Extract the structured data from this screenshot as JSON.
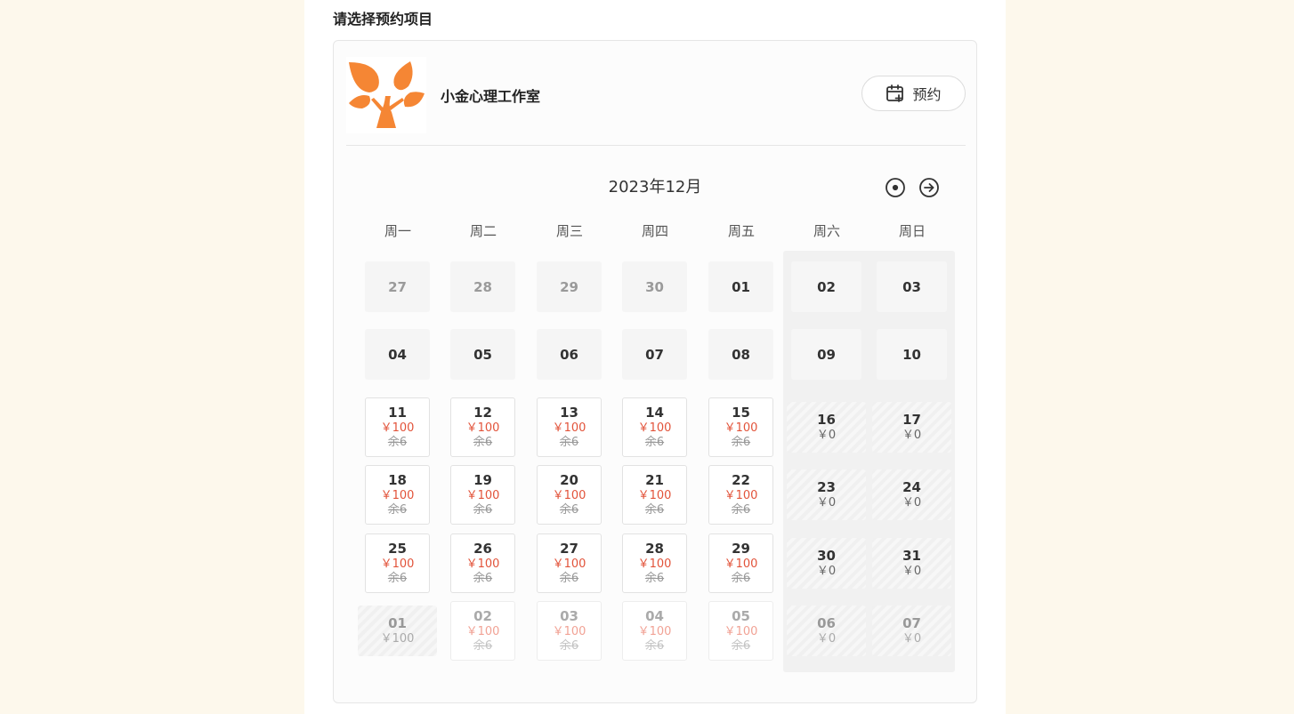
{
  "page": {
    "section_title": "请选择预约项目"
  },
  "studio": {
    "name": "小金心理工作室",
    "logo": "tree-logo",
    "brand_color": "#f58634"
  },
  "book_button": {
    "label": "预约",
    "icon": "calendar-add-icon"
  },
  "calendar": {
    "month_title": "2023年12月",
    "today_icon": "target-circle-icon",
    "next_icon": "arrow-right-circle-icon",
    "weekdays": [
      "周一",
      "周二",
      "周三",
      "周四",
      "周五",
      "周六",
      "周日"
    ],
    "colors": {
      "price": "#e2533a",
      "closed_bg": "#f1f1f1"
    },
    "weeks": [
      [
        {
          "day": "27",
          "type": "empty",
          "dim": true
        },
        {
          "day": "28",
          "type": "empty",
          "dim": true
        },
        {
          "day": "29",
          "type": "empty",
          "dim": true
        },
        {
          "day": "30",
          "type": "empty",
          "dim": true
        },
        {
          "day": "01",
          "type": "empty"
        },
        {
          "day": "02",
          "type": "empty"
        },
        {
          "day": "03",
          "type": "empty"
        }
      ],
      [
        {
          "day": "04",
          "type": "empty"
        },
        {
          "day": "05",
          "type": "empty"
        },
        {
          "day": "06",
          "type": "empty"
        },
        {
          "day": "07",
          "type": "empty"
        },
        {
          "day": "08",
          "type": "empty"
        },
        {
          "day": "09",
          "type": "empty"
        },
        {
          "day": "10",
          "type": "empty"
        }
      ],
      [
        {
          "day": "11",
          "type": "avail",
          "price": "￥100",
          "remain": "余6"
        },
        {
          "day": "12",
          "type": "avail",
          "price": "￥100",
          "remain": "余6"
        },
        {
          "day": "13",
          "type": "avail",
          "price": "￥100",
          "remain": "余6"
        },
        {
          "day": "14",
          "type": "avail",
          "price": "￥100",
          "remain": "余6"
        },
        {
          "day": "15",
          "type": "avail",
          "price": "￥100",
          "remain": "余6"
        },
        {
          "day": "16",
          "type": "closed",
          "price": "￥0"
        },
        {
          "day": "17",
          "type": "closed",
          "price": "￥0"
        }
      ],
      [
        {
          "day": "18",
          "type": "avail",
          "price": "￥100",
          "remain": "余6"
        },
        {
          "day": "19",
          "type": "avail",
          "price": "￥100",
          "remain": "余6"
        },
        {
          "day": "20",
          "type": "avail",
          "price": "￥100",
          "remain": "余6"
        },
        {
          "day": "21",
          "type": "avail",
          "price": "￥100",
          "remain": "余6"
        },
        {
          "day": "22",
          "type": "avail",
          "price": "￥100",
          "remain": "余6"
        },
        {
          "day": "23",
          "type": "closed",
          "price": "￥0"
        },
        {
          "day": "24",
          "type": "closed",
          "price": "￥0"
        }
      ],
      [
        {
          "day": "25",
          "type": "avail",
          "price": "￥100",
          "remain": "余6"
        },
        {
          "day": "26",
          "type": "avail",
          "price": "￥100",
          "remain": "余6"
        },
        {
          "day": "27",
          "type": "avail",
          "price": "￥100",
          "remain": "余6"
        },
        {
          "day": "28",
          "type": "avail",
          "price": "￥100",
          "remain": "余6"
        },
        {
          "day": "29",
          "type": "avail",
          "price": "￥100",
          "remain": "余6"
        },
        {
          "day": "30",
          "type": "closed",
          "price": "￥0"
        },
        {
          "day": "31",
          "type": "closed",
          "price": "￥0"
        }
      ],
      [
        {
          "day": "01",
          "type": "closed",
          "price": "￥100",
          "dim": true
        },
        {
          "day": "02",
          "type": "avail",
          "price": "￥100",
          "remain": "余6",
          "dim": true
        },
        {
          "day": "03",
          "type": "avail",
          "price": "￥100",
          "remain": "余6",
          "dim": true
        },
        {
          "day": "04",
          "type": "avail",
          "price": "￥100",
          "remain": "余6",
          "dim": true
        },
        {
          "day": "05",
          "type": "avail",
          "price": "￥100",
          "remain": "余6",
          "dim": true
        },
        {
          "day": "06",
          "type": "closed",
          "price": "￥0",
          "dim": true
        },
        {
          "day": "07",
          "type": "closed",
          "price": "￥0",
          "dim": true
        }
      ]
    ]
  }
}
